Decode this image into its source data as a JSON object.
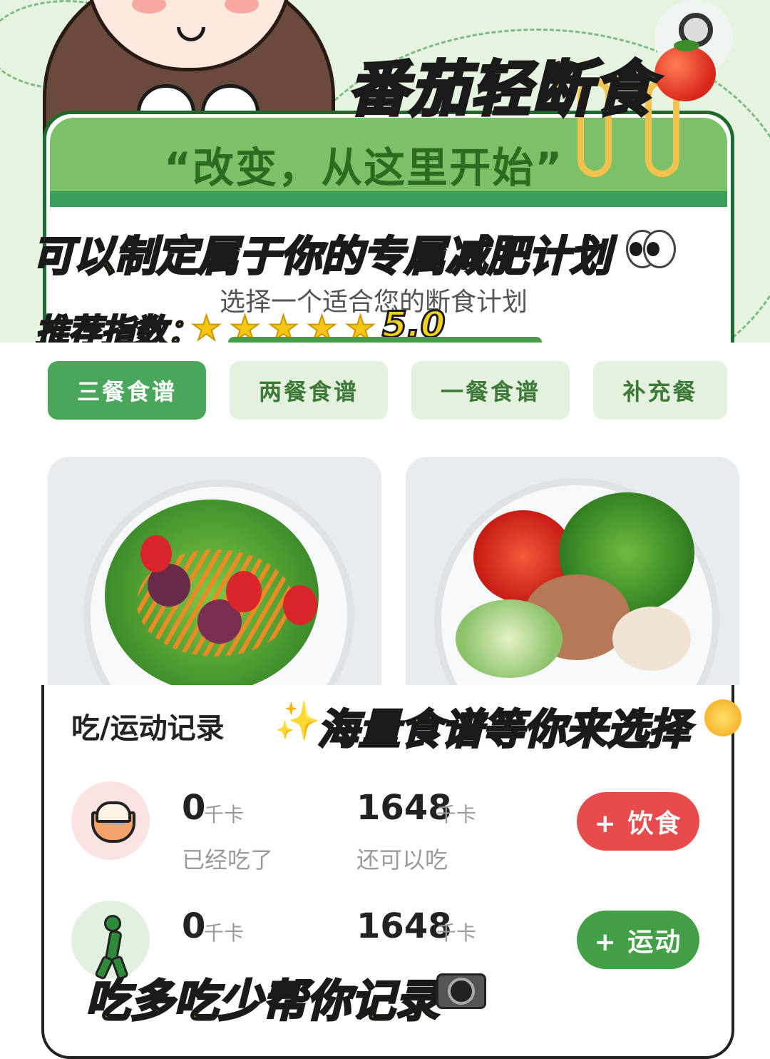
{
  "banner": {
    "brand_title": "番茄轻断食",
    "slogan": "“改变，从这里开始”",
    "plan_title": "可以制定属于你的专属减肥计划",
    "subtitle": "选择一个适合您的断食计划",
    "rating_label": "推荐指数：",
    "rating_stars": "★",
    "rating_value": "5.0"
  },
  "tabs": [
    {
      "label": "三餐食谱",
      "active": true
    },
    {
      "label": "两餐食谱",
      "active": false
    },
    {
      "label": "一餐食谱",
      "active": false
    },
    {
      "label": "补充餐",
      "active": false
    }
  ],
  "record": {
    "title": "吃/运动记录",
    "recipes_caption": "海量食谱等你来选择",
    "sparkle": "✨",
    "eat_row": {
      "consumed_value": "0",
      "consumed_unit": "千卡",
      "consumed_label": "已经吃了",
      "remaining_value": "1648",
      "remaining_unit": "千卡",
      "remaining_label": "还可以吃",
      "add_button": "+ 饮食"
    },
    "exercise_row": {
      "burned_value": "0",
      "burned_unit": "千卡",
      "basal_value": "1648",
      "basal_unit": "千卡",
      "add_button": "+ 运动"
    },
    "bottom_caption": "吃多吃少帮你记录"
  },
  "colors": {
    "accent_green": "#49a65a",
    "tab_inactive_bg": "#e3f1de",
    "eat_button": "#e84b4b",
    "exercise_button": "#43a047",
    "caption_yellow": "#f4d21a"
  },
  "icons": [
    "food-bowl-icon",
    "walking-person-icon",
    "tomato-icon",
    "user-icon",
    "camera-icon",
    "eyes-icon",
    "star-icon"
  ]
}
